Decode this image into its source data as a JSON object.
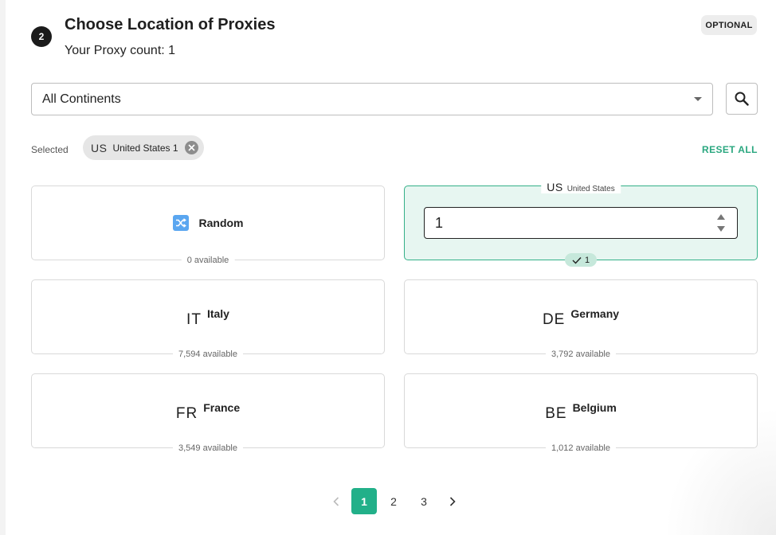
{
  "step": {
    "number": "2",
    "title": "Choose Location of Proxies",
    "proxy_count_text": "Your Proxy count: 1",
    "optional_badge": "OPTIONAL"
  },
  "filter": {
    "continent_value": "All Continents",
    "search_icon": "search-icon"
  },
  "selected": {
    "label": "Selected",
    "chips": [
      {
        "code": "US",
        "text": "United States 1"
      }
    ],
    "reset_label": "RESET ALL"
  },
  "cards": {
    "random": {
      "label": "Random",
      "available": "0 available",
      "icon": "shuffle-icon"
    },
    "selected_card": {
      "code": "US",
      "name": "United States",
      "quantity": "1",
      "count_badge": "1"
    },
    "italy": {
      "code": "IT",
      "name": "Italy",
      "available": "7,594 available"
    },
    "germany": {
      "code": "DE",
      "name": "Germany",
      "available": "3,792 available"
    },
    "france": {
      "code": "FR",
      "name": "France",
      "available": "3,549 available"
    },
    "belgium": {
      "code": "BE",
      "name": "Belgium",
      "available": "1,012 available"
    }
  },
  "pagination": {
    "pages": [
      "1",
      "2",
      "3"
    ],
    "active_page": "1",
    "prev_icon": "chevron-left-icon",
    "next_icon": "chevron-right-icon"
  },
  "colors": {
    "accent": "#22b089",
    "selected_card_bg": "#e7f6f1",
    "badge_bg": "#ededed"
  }
}
